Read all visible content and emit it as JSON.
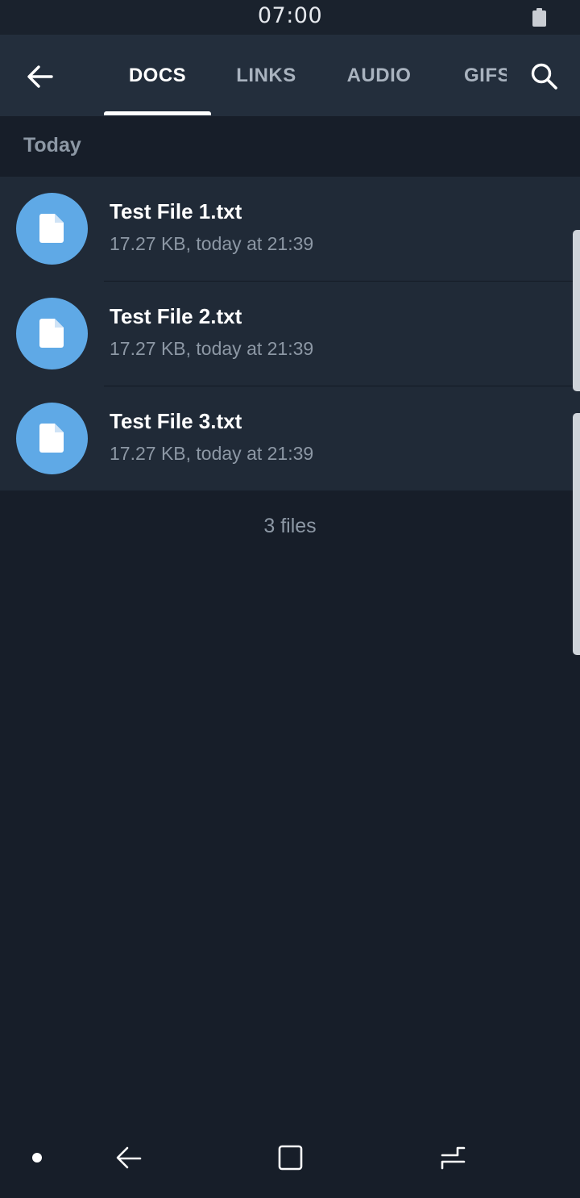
{
  "status_bar": {
    "time": "07:00",
    "battery_icon": "battery-icon"
  },
  "top_bar": {
    "back_icon": "arrow-left-icon",
    "search_icon": "search-icon",
    "tabs": [
      {
        "label": "DOCS",
        "active": true
      },
      {
        "label": "LINKS",
        "active": false
      },
      {
        "label": "AUDIO",
        "active": false
      },
      {
        "label": "GIFS",
        "active": false
      }
    ]
  },
  "section": {
    "title": "Today"
  },
  "files": [
    {
      "name": "Test File 1.txt",
      "meta": "17.27 KB, today at 21:39",
      "icon": "document-icon"
    },
    {
      "name": "Test File 2.txt",
      "meta": "17.27 KB, today at 21:39",
      "icon": "document-icon"
    },
    {
      "name": "Test File 3.txt",
      "meta": "17.27 KB, today at 21:39",
      "icon": "document-icon"
    }
  ],
  "footer": {
    "count": "3 files"
  },
  "nav_bar": {
    "items": [
      "dot-icon",
      "back-icon",
      "home-icon",
      "recents-icon"
    ]
  },
  "colors": {
    "accent": "#5fa9e6",
    "background": "#171e29",
    "header": "#232e3c",
    "list": "#202a37"
  }
}
